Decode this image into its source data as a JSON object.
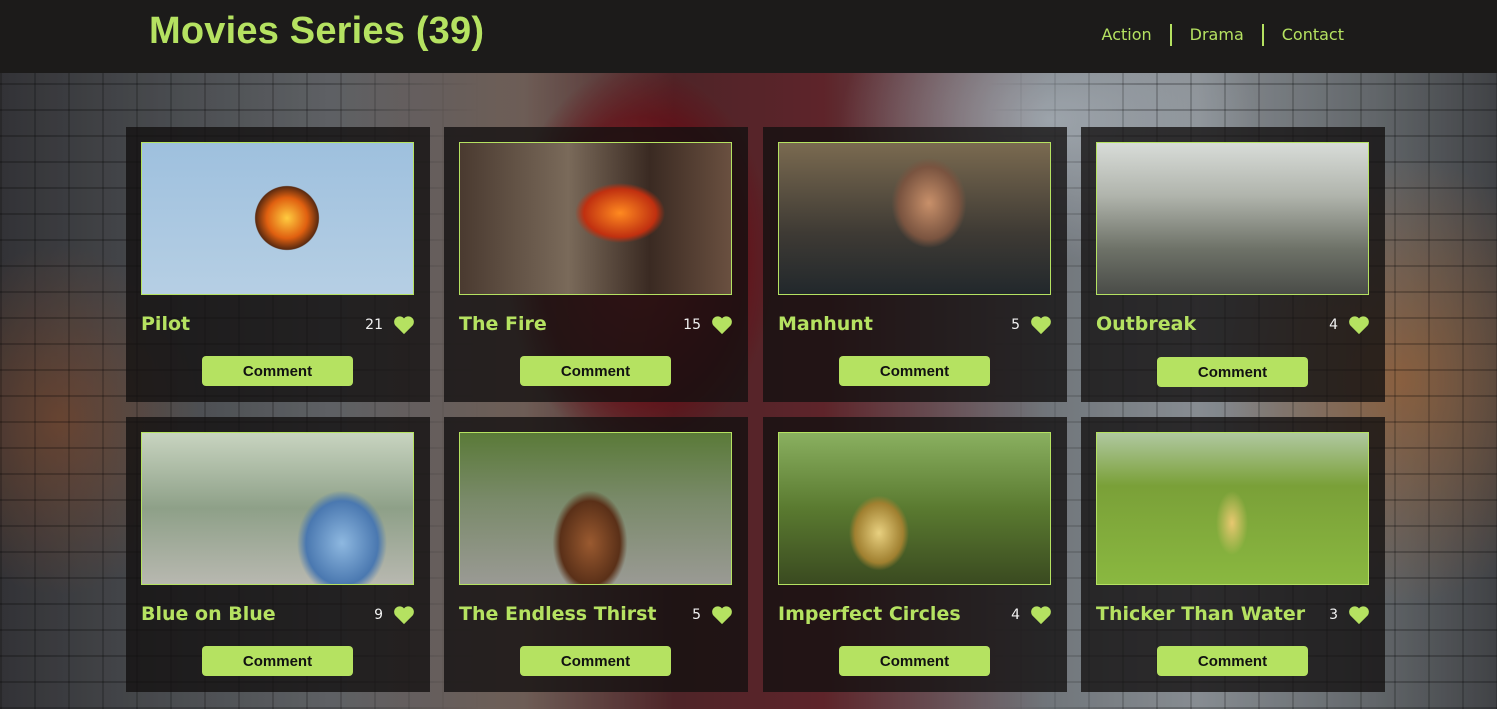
{
  "header": {
    "title": "Movies Series (39)",
    "nav": [
      {
        "label": "Action"
      },
      {
        "label": "Drama"
      },
      {
        "label": "Contact"
      }
    ]
  },
  "colors": {
    "accent": "#b5e261",
    "header_bg": "#1c1b1a",
    "card_bg": "#121010"
  },
  "cards": [
    {
      "title": "Pilot",
      "likes": "21",
      "button": "Comment",
      "icon": "heart-icon"
    },
    {
      "title": "The Fire",
      "likes": "15",
      "button": "Comment",
      "icon": "heart-icon"
    },
    {
      "title": "Manhunt",
      "likes": "5",
      "button": "Comment",
      "icon": "heart-icon"
    },
    {
      "title": "Outbreak",
      "likes": "4",
      "button": "Comment",
      "icon": "heart-icon"
    },
    {
      "title": "Blue on Blue",
      "likes": "9",
      "button": "Comment",
      "icon": "heart-icon"
    },
    {
      "title": "The Endless Thirst",
      "likes": "5",
      "button": "Comment",
      "icon": "heart-icon"
    },
    {
      "title": "Imperfect Circles",
      "likes": "4",
      "button": "Comment",
      "icon": "heart-icon"
    },
    {
      "title": "Thicker Than Water",
      "likes": "3",
      "button": "Comment",
      "icon": "heart-icon"
    }
  ]
}
